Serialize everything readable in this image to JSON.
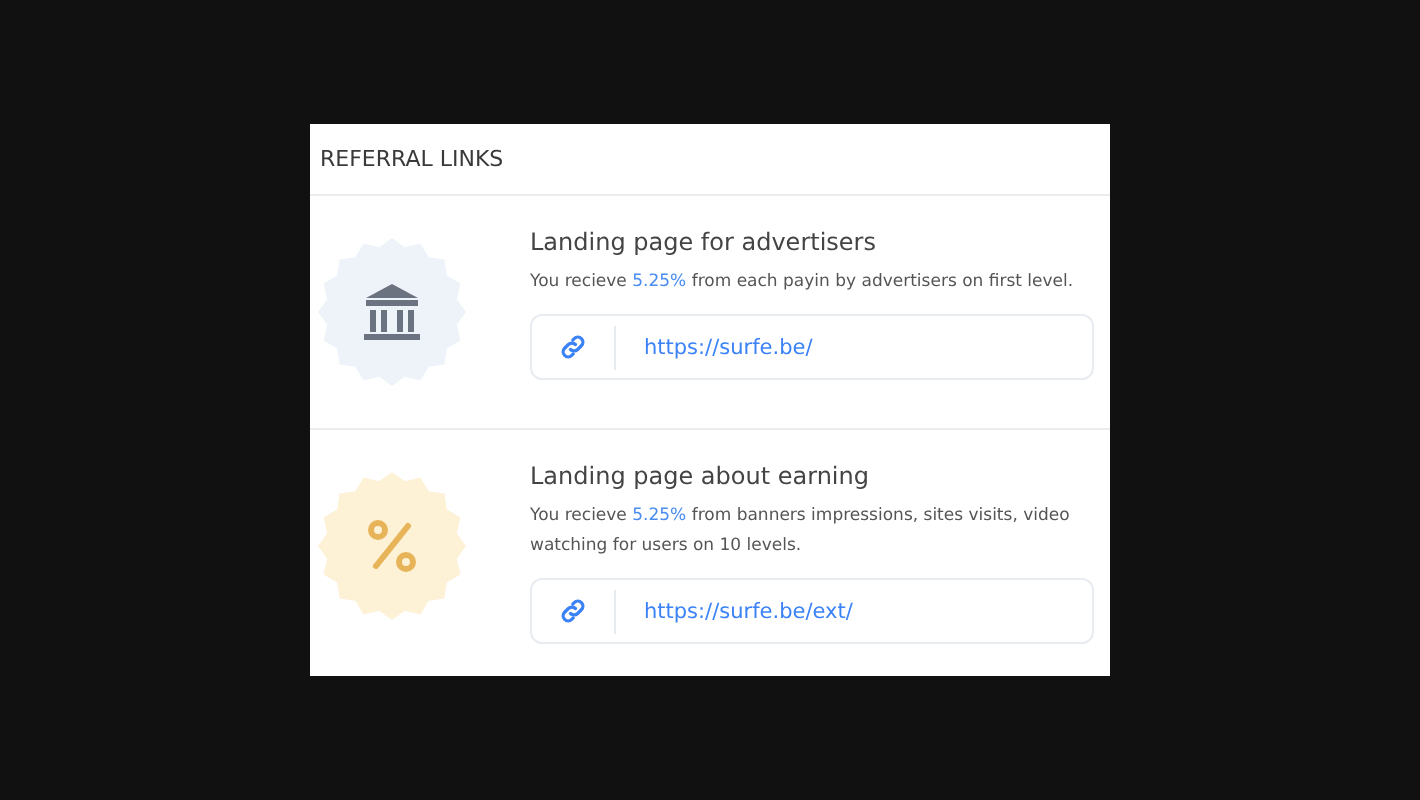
{
  "panel": {
    "title": "REFERRAL LINKS"
  },
  "links": [
    {
      "kind": "bank",
      "color": "#eef3fa",
      "title": "Landing page for advertisers",
      "description_start": "You recieve ",
      "rate": "5.25%",
      "description_end": " from each payin by advertisers on first level.",
      "url": "https://surfe.be/"
    },
    {
      "kind": "percent",
      "color": "#fdf1d6",
      "title": "Landing page about earning",
      "description_start": "You recieve ",
      "rate": "5.25%",
      "description_end": " from banners impressions, sites visits, video watching for users on 10 levels.",
      "url": "https://surfe.be/ext/"
    }
  ]
}
